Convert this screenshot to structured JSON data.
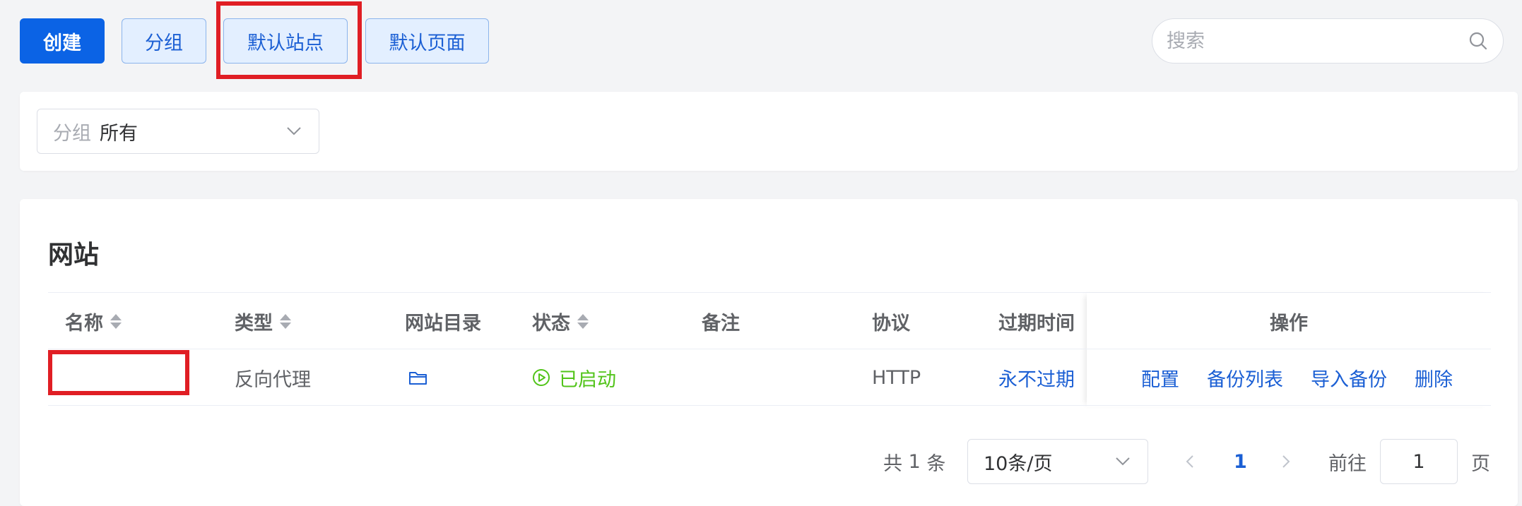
{
  "toolbar": {
    "create_label": "创建",
    "group_label": "分组",
    "default_site_label": "默认站点",
    "default_page_label": "默认页面",
    "search_placeholder": "搜索"
  },
  "filter": {
    "prefix": "分组",
    "value": "所有"
  },
  "table": {
    "title": "网站",
    "columns": {
      "name": "名称",
      "type": "类型",
      "dir": "网站目录",
      "status": "状态",
      "remark": "备注",
      "protocol": "协议",
      "expire": "过期时间",
      "actions": "操作"
    },
    "rows": [
      {
        "name": "",
        "type": "反向代理",
        "status": "已启动",
        "remark": "",
        "protocol": "HTTP",
        "expire": "永不过期",
        "actions": [
          "配置",
          "备份列表",
          "导入备份",
          "删除"
        ]
      }
    ]
  },
  "pagination": {
    "total_prefix": "共",
    "total": "1",
    "total_suffix": "条",
    "page_size": "10条/页",
    "current_page": "1",
    "goto_label": "前往",
    "goto_value": "1",
    "goto_suffix": "页"
  },
  "colors": {
    "primary": "#0b63e5",
    "highlight": "#e01e24",
    "status_running": "#52c41a"
  }
}
